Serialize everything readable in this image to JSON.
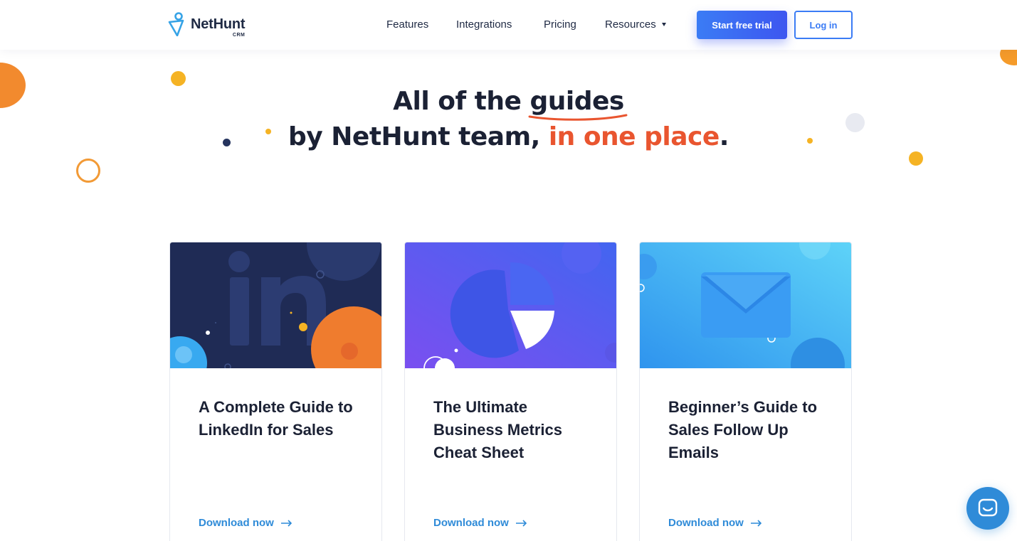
{
  "header": {
    "logo": {
      "name": "NetHunt",
      "sub": "CRM"
    },
    "nav": [
      {
        "label": "Features"
      },
      {
        "label": "Integrations"
      },
      {
        "label": "Pricing"
      },
      {
        "label": "Resources",
        "dropdown": true
      }
    ],
    "trial_button": "Start free trial",
    "login_button": "Log in"
  },
  "hero": {
    "line1_pre": "All of the ",
    "line1_highlight": "guides",
    "line2_pre": "by NetHunt team, ",
    "line2_accent": "in one place",
    "line2_post": "."
  },
  "colors": {
    "accent_orange": "#e9552f",
    "primary_blue": "#3d56f0",
    "link_blue": "#2f8bd8",
    "text_dark": "#1b2134"
  },
  "cards": [
    {
      "title": "A Complete Guide to LinkedIn for Sales",
      "link": "Download now",
      "icon": "linkedin-logo-illustration"
    },
    {
      "title": "The Ultimate Business Metrics Cheat Sheet",
      "link": "Download now",
      "icon": "pie-chart-illustration"
    },
    {
      "title": "Beginner’s Guide to Sales Follow Up Emails",
      "link": "Download now",
      "icon": "envelope-illustration"
    }
  ],
  "chat": {
    "icon": "chat-icon"
  }
}
